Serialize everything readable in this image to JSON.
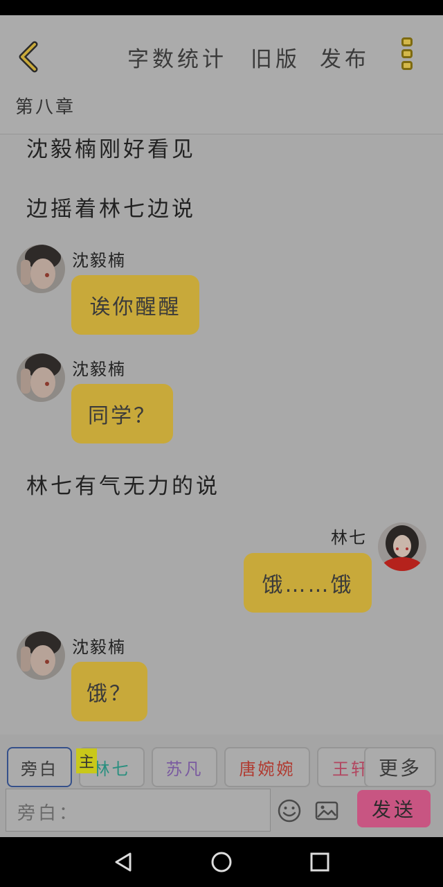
{
  "header": {
    "word_count_label": "字数统计",
    "old_version_label": "旧版",
    "publish_label": "发布",
    "chapter_title": "第八章"
  },
  "story": {
    "narration_1": "沈毅楠刚好看见",
    "narration_2": "边摇着林七边说",
    "narration_3": "林七有气无力的说",
    "messages": [
      {
        "sender": "沈毅楠",
        "text": "诶你醒醒"
      },
      {
        "sender": "沈毅楠",
        "text": "同学？"
      },
      {
        "sender": "林七",
        "text": "饿……饿"
      },
      {
        "sender": "沈毅楠",
        "text": "饿？"
      }
    ]
  },
  "composer": {
    "characters": [
      {
        "label": "旁白",
        "color": "#3a3a3a"
      },
      {
        "label": "林七",
        "color": "#2a8f7f"
      },
      {
        "label": "苏凡",
        "color": "#7a5aa0"
      },
      {
        "label": "唐婉婉",
        "color": "#b03a30"
      },
      {
        "label": "王轩",
        "color": "#b2455f"
      }
    ],
    "main_tag": "主",
    "more_label": "更多",
    "input_placeholder": "旁白：",
    "send_label": "发送"
  },
  "colors": {
    "bubble": "#c8a93a",
    "send": "#c85582",
    "accent_back": "#c8a93a"
  },
  "icons": {
    "back": "chevron-left-icon",
    "more": "more-vertical-icon",
    "emoji": "smiley-icon",
    "image": "image-icon",
    "nav_back": "triangle-back-icon",
    "nav_home": "circle-home-icon",
    "nav_recent": "square-recent-icon"
  }
}
